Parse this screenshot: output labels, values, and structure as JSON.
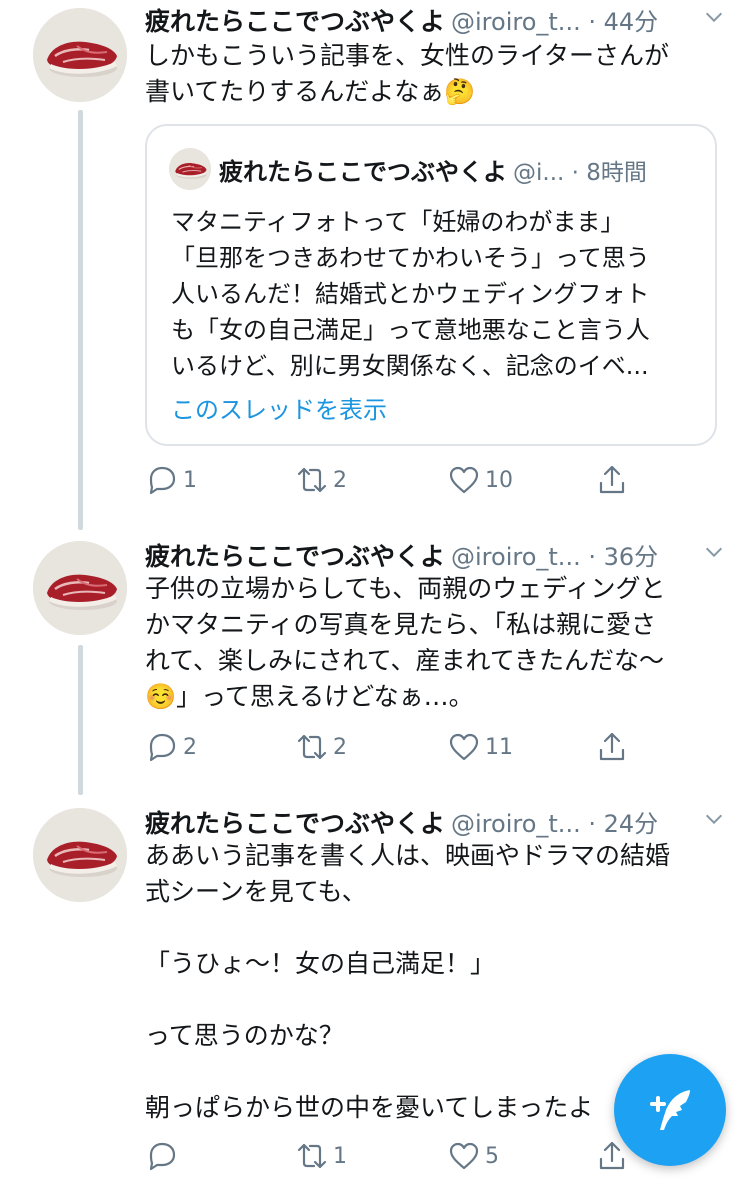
{
  "tweets": [
    {
      "name": "疲れたらここでつぶやくよ",
      "handle": "@iroiro_t... · 44分",
      "text": "しかもこういう記事を、女性のライターさんが\n書いてたりするんだよなぁ🤔",
      "quote": {
        "name": "疲れたらここでつぶやくよ",
        "handle": "@i... · 8時間",
        "lines": [
          "マタニティフォトって「妊婦のわがまま」",
          "「旦那をつきあわせてかわいそう」って思う",
          "人いるんだ！結婚式とかウェディングフォト",
          "も「女の自己満足」って意地悪なこと言う人",
          "いるけど、別に男女関係なく、記念のイベ..."
        ],
        "thread_link": "このスレッドを表示"
      },
      "replies": "1",
      "retweets": "2",
      "likes": "10"
    },
    {
      "name": "疲れたらここでつぶやくよ",
      "handle": "@iroiro_t... · 36分",
      "text": "子供の立場からしても、両親のウェディングと\nかマタニティの写真を見たら、「私は親に愛さ\nれて、楽しみにされて、産まれてきたんだな〜\n☺️」って思えるけどなぁ…。",
      "replies": "2",
      "retweets": "2",
      "likes": "11"
    },
    {
      "name": "疲れたらここでつぶやくよ",
      "handle": "@iroiro_t... · 24分",
      "text": "ああいう記事を書く人は、映画やドラマの結婚\n式シーンを見ても、\n\n「うひょ〜！女の自己満足！」\n\nって思うのかな？\n\n朝っぱらから世の中を憂いてしまったよ",
      "replies": "",
      "retweets": "1",
      "likes": "5"
    }
  ],
  "icons": {
    "reply": "reply-icon",
    "retweet": "retweet-icon",
    "like": "heart-icon",
    "share": "share-icon",
    "menu": "chevron-down-icon",
    "compose": "compose-tweet-icon"
  },
  "colors": {
    "accent": "#1da1f2",
    "link": "#1b95e0",
    "muted": "#657786",
    "thread_line": "#cfd9de"
  }
}
